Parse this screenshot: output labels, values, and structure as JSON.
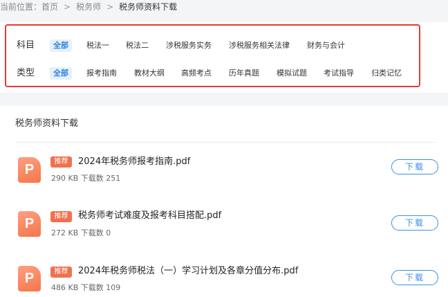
{
  "breadcrumb": {
    "label": "当前位置：",
    "items": [
      "首页",
      "税务师",
      "税务师资料下载"
    ]
  },
  "filters": {
    "subject": {
      "label": "科目",
      "options": [
        "全部",
        "税法一",
        "税法二",
        "涉税服务实务",
        "涉税服务相关法律",
        "财务与会计"
      ],
      "selected": "全部"
    },
    "type": {
      "label": "类型",
      "options": [
        "全部",
        "报考指南",
        "教材大纲",
        "高频考点",
        "历年真题",
        "模拟试题",
        "考试指导",
        "归类记忆"
      ],
      "selected": "全部"
    }
  },
  "section": {
    "title": "税务师资料下载"
  },
  "files": [
    {
      "icon": "P",
      "badge": "推荐",
      "name": "2024年税务师报考指南.pdf",
      "meta": "290 KB 下载数 251",
      "button": "下载"
    },
    {
      "icon": "P",
      "badge": "推荐",
      "name": "税务师考试难度及报考科目搭配.pdf",
      "meta": "272 KB 下载数 0",
      "button": "下载"
    },
    {
      "icon": "P",
      "badge": "推荐",
      "name": "2024年税务师税法（一）学习计划及各章分值分布.pdf",
      "meta": "486 KB 下载数 109",
      "button": "下载"
    }
  ],
  "colors": {
    "accent": "#2e86de",
    "highlight_frame": "#e53935",
    "badge": "#f0714f",
    "file_icon": "#f4764c"
  }
}
